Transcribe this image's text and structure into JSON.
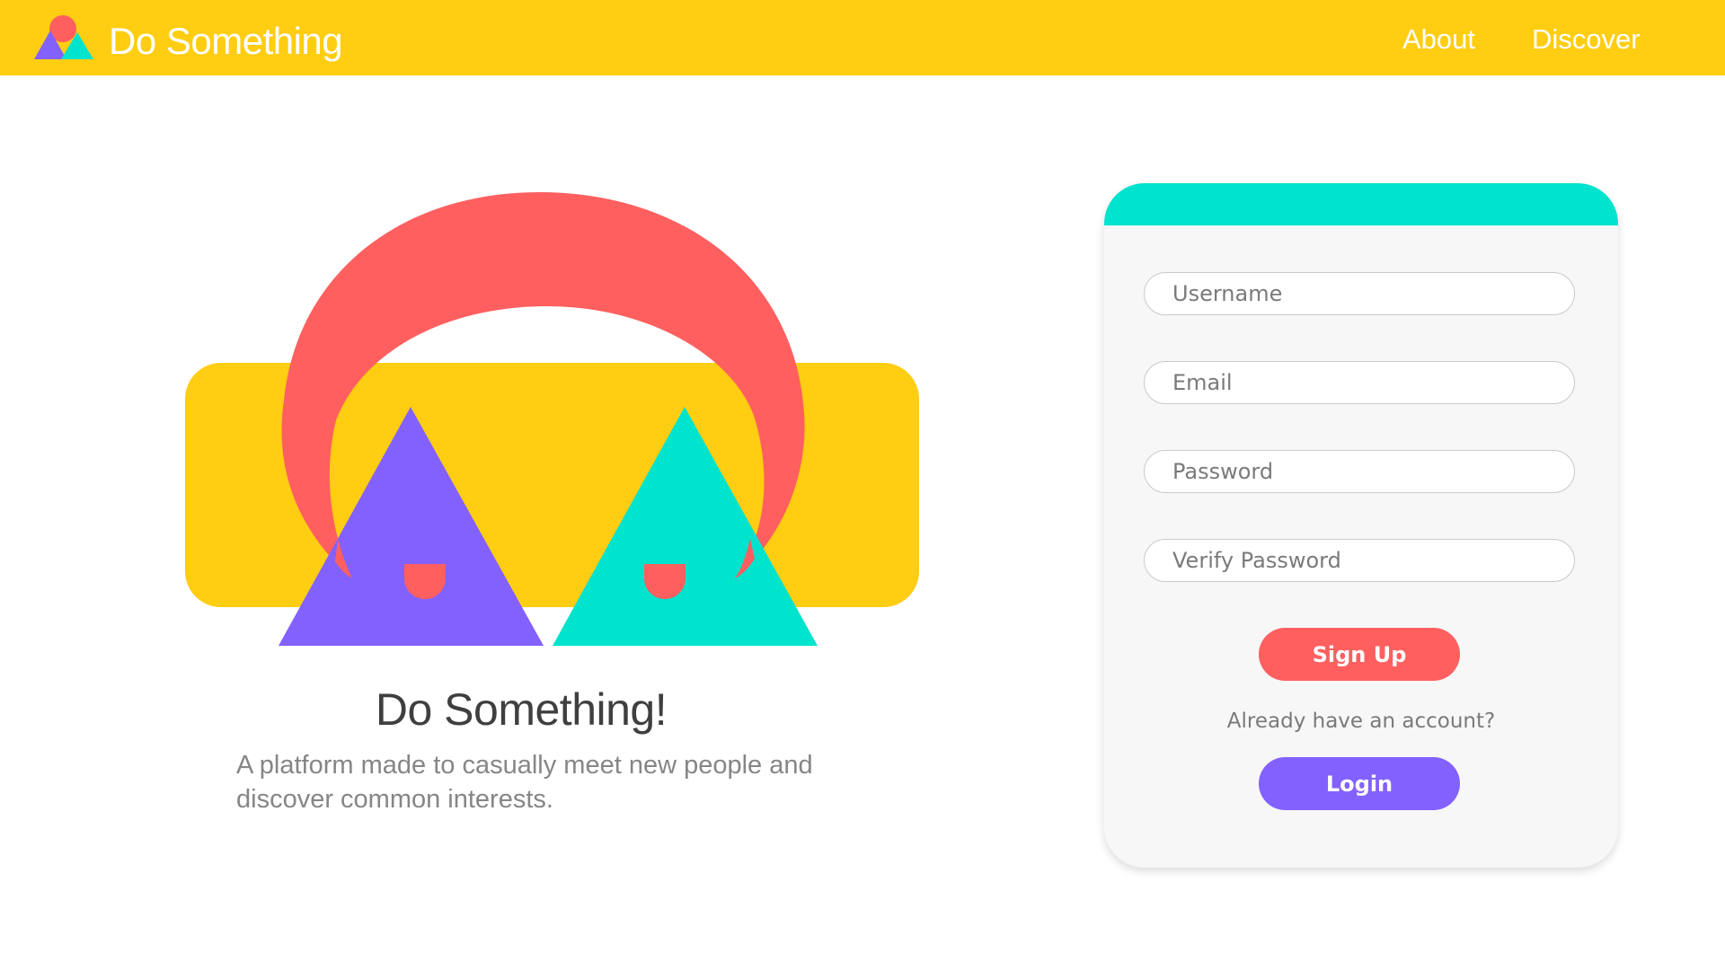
{
  "header": {
    "brand": "Do Something",
    "nav": [
      {
        "label": "About"
      },
      {
        "label": "Discover"
      }
    ]
  },
  "hero": {
    "title": "Do Something!",
    "subtitle": "A platform made to casually meet new people and discover common interests."
  },
  "form": {
    "fields": {
      "username_placeholder": "Username",
      "email_placeholder": "Email",
      "password_placeholder": "Password",
      "verify_placeholder": "Verify Password"
    },
    "signup_label": "Sign Up",
    "already_text": "Already have an account?",
    "login_label": "Login"
  },
  "colors": {
    "yellow": "#ffcd12",
    "coral": "#ff5f5f",
    "purple": "#8361ff",
    "teal": "#00e3cd"
  }
}
